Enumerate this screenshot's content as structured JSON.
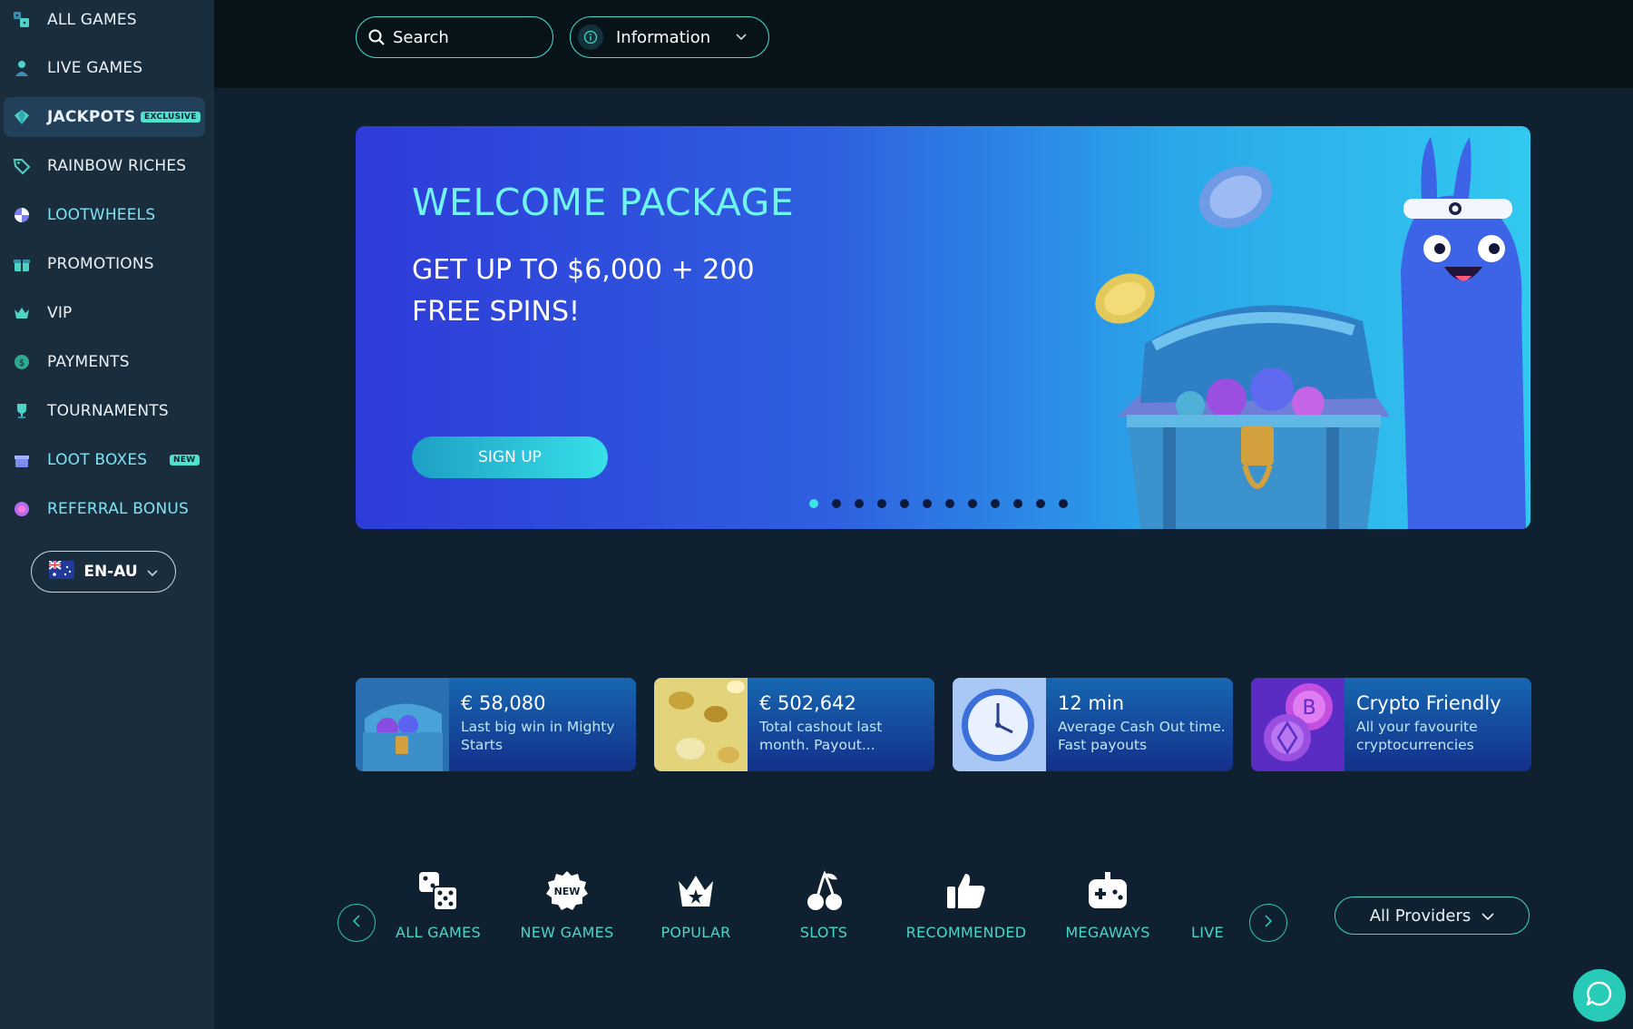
{
  "sidebar": {
    "items": [
      {
        "label": "ALL GAMES",
        "icon": "games-grid-icon"
      },
      {
        "label": "LIVE GAMES",
        "icon": "dealer-icon"
      },
      {
        "label": "JACKPOTS",
        "icon": "diamond-icon",
        "badge": "EXCLUSIVE"
      },
      {
        "label": "RAINBOW RICHES",
        "icon": "tag-icon"
      },
      {
        "label": "LOOTWHEELS",
        "icon": "wheel-icon"
      },
      {
        "label": "PROMOTIONS",
        "icon": "gift-icon"
      },
      {
        "label": "VIP",
        "icon": "crown-icon"
      },
      {
        "label": "PAYMENTS",
        "icon": "coin-icon"
      },
      {
        "label": "TOURNAMENTS",
        "icon": "trophy-icon"
      },
      {
        "label": "LOOT BOXES",
        "icon": "lootbox-icon",
        "badge": "NEW"
      },
      {
        "label": "REFERRAL BONUS",
        "icon": "referral-icon"
      }
    ],
    "language": "EN-AU"
  },
  "topbar": {
    "search_label": "Search",
    "info_label": "Information"
  },
  "hero": {
    "title": "WELCOME PACKAGE",
    "subtitle": "GET UP TO $6,000 + 200 FREE SPINS!",
    "cta": "SIGN UP",
    "slides_total": 12,
    "active_slide": 1
  },
  "stats": [
    {
      "value": "€ 58,080",
      "desc": "Last big win in Mighty Starts",
      "icon": "treasure-chest-icon"
    },
    {
      "value": "€ 502,642",
      "desc": "Total cashout last month. Payout...",
      "icon": "gold-coins-icon"
    },
    {
      "value": "12 min",
      "desc": "Average Cash Out time. Fast payouts",
      "icon": "clock-icon"
    },
    {
      "value": "Crypto Friendly",
      "desc": "All your favourite cryptocurrencies",
      "icon": "crypto-coins-icon"
    }
  ],
  "categories": [
    {
      "label": "ALL GAMES",
      "icon": "dice-icon"
    },
    {
      "label": "NEW GAMES",
      "icon": "new-badge-icon"
    },
    {
      "label": "POPULAR",
      "icon": "crown-star-icon"
    },
    {
      "label": "SLOTS",
      "icon": "cherry-icon"
    },
    {
      "label": "RECOMMENDED",
      "icon": "thumbs-up-icon"
    },
    {
      "label": "MEGAWAYS",
      "icon": "gamepad-icon"
    },
    {
      "label": "LIVE",
      "icon": "live-icon"
    }
  ],
  "providers_label": "All Providers",
  "colors": {
    "accent": "#3fd9c6",
    "sidebar_bg": "#1a2d3d",
    "page_bg": "#0f2130",
    "hero_title": "#6ff4ef"
  }
}
